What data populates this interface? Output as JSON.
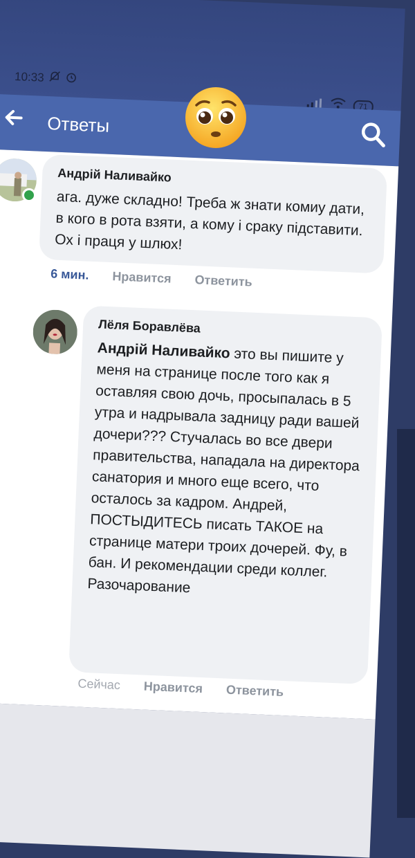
{
  "status_bar": {
    "time": "10:33",
    "battery": "71"
  },
  "app_bar": {
    "title": "Ответы"
  },
  "comments": [
    {
      "author": "Андрій Наливайко",
      "text": "ага. дуже складно! Треба ж знати комиу дати, в кого в рота взяти, а кому і сраку підставити. Ох і праця у шлюх!",
      "time": "6 мин.",
      "like": "Нравится",
      "reply": "Ответить"
    },
    {
      "author": "Лёля Боравлёва",
      "mention": "Андрій Наливайко",
      "text": " это вы пишите у меня на странице после того как я оставляя свою дочь, просыпалась в 5 утра и надрывала задницу ради вашей дочери??? Стучалась во все двери правительства, нападала на директора санатория и много еще всего, что осталось за кадром. Андрей, ПОСТЫДИТЕСЬ писать ТАКОЕ на странице матери троих дочерей. Фу, в бан. И рекомендации среди коллег. Разочарование",
      "time": "Сейчас",
      "like": "Нравится",
      "reply": "Ответить"
    }
  ],
  "colors": {
    "app_bar": "#4a67ad",
    "link": "#385898",
    "online": "#31a24c"
  },
  "icons": [
    "back-arrow-icon",
    "search-icon",
    "bell-off-icon",
    "alarm-icon",
    "signal-icon",
    "wifi-icon",
    "battery-icon",
    "pleading-face-emoji"
  ]
}
